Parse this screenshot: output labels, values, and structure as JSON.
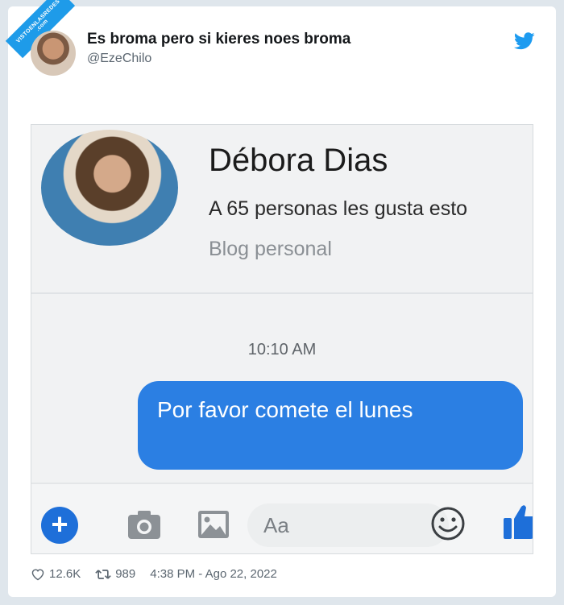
{
  "watermark": {
    "line1": "VISTOENLASREDES",
    "line2": ".com"
  },
  "tweet": {
    "display_name": "Es broma pero si kieres noes broma",
    "handle": "@EzeChilo",
    "likes": "12.6K",
    "retweets": "989",
    "timestamp": "4:38 PM - Ago 22, 2022"
  },
  "messenger": {
    "contact_name": "Débora Dias",
    "likes_text": "A 65 personas les gusta esto",
    "category": "Blog personal",
    "message_time": "10:10 AM",
    "message_text": "Por favor comete el lunes",
    "composer_placeholder": "Aa"
  },
  "colors": {
    "twitter_blue": "#1d9bf0",
    "bubble_blue": "#2b7fe3",
    "messenger_blue": "#1e6fd9"
  },
  "icons": [
    "twitter-bird-icon",
    "heart-icon",
    "retweet-icon",
    "plus-icon",
    "camera-icon",
    "image-icon",
    "smiley-icon",
    "thumbs-up-icon"
  ]
}
